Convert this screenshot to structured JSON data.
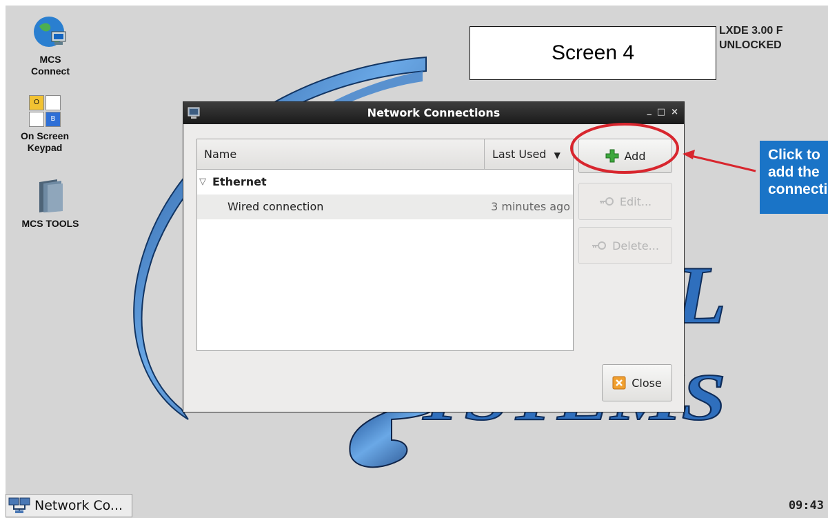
{
  "desktop": {
    "icons": [
      {
        "label_line1": "MCS",
        "label_line2": "Connect"
      },
      {
        "label_line1": "On Screen",
        "label_line2": "Keypad",
        "key_o": "O",
        "key_b": "B"
      },
      {
        "label_line1": "MCS TOOLS",
        "label_line2": ""
      }
    ],
    "status_line1": "LXDE 3.00 F",
    "status_line2": "UNLOCKED",
    "screen_label": "Screen 4",
    "callout_text": "Click to\nadd the\nconnection"
  },
  "window": {
    "title": "Network Connections",
    "minimize": "_",
    "maximize": "□",
    "close": "×",
    "columns": {
      "name": "Name",
      "last_used": "Last Used"
    },
    "groups": [
      {
        "name": "Ethernet",
        "connections": [
          {
            "name": "Wired connection",
            "last_used": "3 minutes ago"
          }
        ]
      }
    ],
    "buttons": {
      "add": "Add",
      "edit": "Edit...",
      "delete": "Delete...",
      "close": "Close"
    }
  },
  "taskbar": {
    "task_label": "Network Co...",
    "clock": "09:43"
  },
  "colors": {
    "desktop_bg": "#d5d5d5",
    "callout_bg": "#1a74c7",
    "highlight_ring": "#d8262e",
    "swirl": "#2c6fb8"
  }
}
